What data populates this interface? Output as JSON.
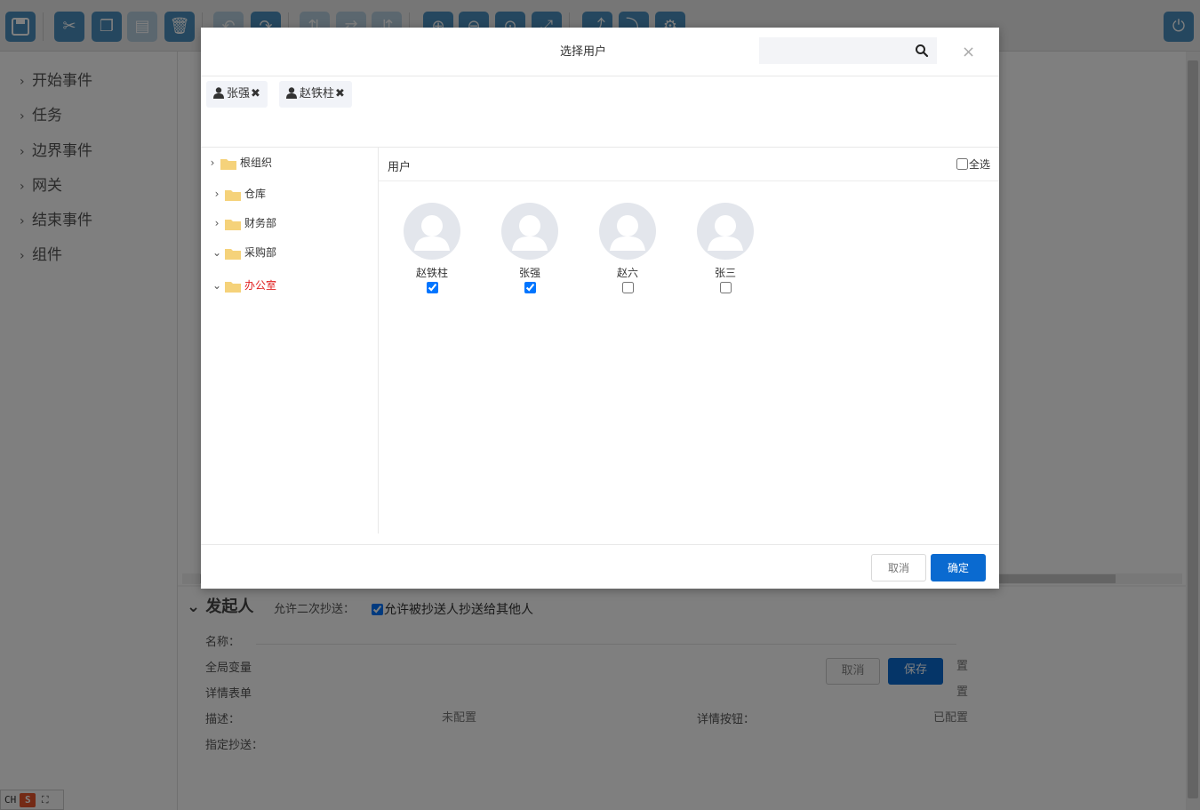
{
  "background": {
    "sidebar_items": [
      "开始事件",
      "任务",
      "边界事件",
      "网关",
      "结束事件",
      "组件"
    ],
    "props": {
      "section_title": "发起人",
      "name_label": "名称：",
      "global_var_label": "全局变量",
      "detail_form_label": "详情表单",
      "desc_label": "描述：",
      "desc_value": "未配置",
      "detail_btn_label": "详情按钮：",
      "detail_btn_value": "已配置",
      "cc_label": "指定抄送：",
      "right_value_1": "置",
      "right_value_2": "置"
    },
    "under_dialog": {
      "allow_label": "允许二次抄送：",
      "allow_check_label": "允许被抄送人抄送给其他人",
      "allow_checked": true,
      "cancel_label": "取消",
      "save_label": "保存"
    },
    "ime": {
      "lang": "CH",
      "logo": "S"
    }
  },
  "modal": {
    "title": "选择用户",
    "search": {
      "placeholder": "",
      "value": ""
    },
    "close_glyph": "×",
    "selected_tags": [
      {
        "label": "张强",
        "remove": "✖"
      },
      {
        "label": "赵铁柱",
        "remove": "✖"
      }
    ],
    "tree": [
      {
        "label": "根组织",
        "expanded": false
      },
      {
        "label": "仓库",
        "expanded": false
      },
      {
        "label": "财务部",
        "expanded": false
      },
      {
        "label": "采购部",
        "expanded": true
      },
      {
        "label": "办公室",
        "expanded": true,
        "active": true
      }
    ],
    "users_header": "用户",
    "select_all_label": "全选",
    "select_all_checked": false,
    "users": [
      {
        "name": "赵铁柱",
        "checked": true
      },
      {
        "name": "张强",
        "checked": true
      },
      {
        "name": "赵六",
        "checked": false
      },
      {
        "name": "张三",
        "checked": false
      }
    ],
    "cancel_label": "取消",
    "ok_label": "确定"
  },
  "colors": {
    "primary": "#0a6ad0",
    "active_node": "#e02020",
    "folder": "#f5d27a",
    "toolbar_btn": "#4a8fbf"
  }
}
